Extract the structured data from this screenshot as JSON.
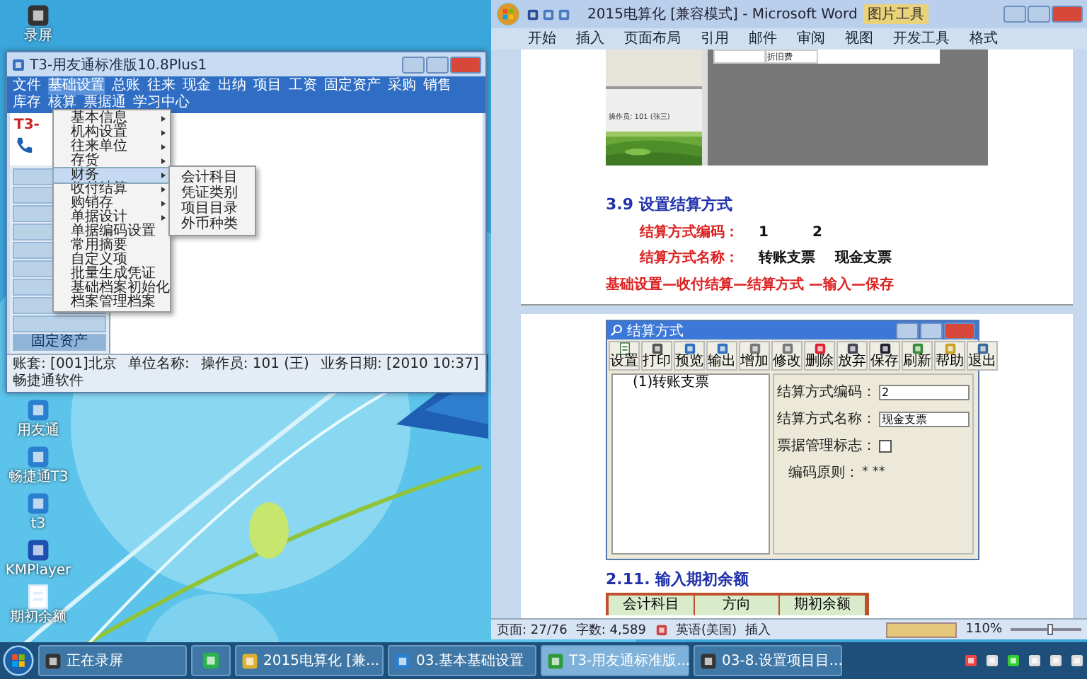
{
  "desktop_icons": [
    {
      "label": "录屏"
    },
    {
      "label": "用友通"
    },
    {
      "label": "畅捷通T3"
    },
    {
      "label": "t3"
    },
    {
      "label": "KMPlayer"
    },
    {
      "label": "期初余额"
    }
  ],
  "t3_window": {
    "title": "T3-用友通标准版10.8Plus1",
    "menu": [
      {
        "label": "文件",
        "selected": false
      },
      {
        "label": "基础设置",
        "selected": true
      },
      {
        "label": "总账",
        "selected": false
      },
      {
        "label": "往来",
        "selected": false
      },
      {
        "label": "现金",
        "selected": false
      },
      {
        "label": "出纳",
        "selected": false
      },
      {
        "label": "项目",
        "selected": false
      },
      {
        "label": "工资",
        "selected": false
      },
      {
        "label": "固定资产",
        "selected": false
      },
      {
        "label": "采购",
        "selected": false
      },
      {
        "label": "销售",
        "selected": false
      },
      {
        "label": "库存",
        "selected": false
      },
      {
        "label": "核算",
        "selected": false
      },
      {
        "label": "票据通",
        "selected": false
      },
      {
        "label": "学习中心",
        "selected": false
      }
    ],
    "logo": "T3-",
    "nav_items": [
      {
        "label": "固定资产",
        "selected": true
      }
    ],
    "dropdown": [
      {
        "label": "基本信息",
        "submenu": true,
        "selected": false
      },
      {
        "label": "机构设置",
        "submenu": true,
        "selected": false
      },
      {
        "label": "往来单位",
        "submenu": true,
        "selected": false
      },
      {
        "label": "存货",
        "submenu": true,
        "selected": false
      },
      {
        "label": "财务",
        "submenu": true,
        "selected": true
      },
      {
        "label": "收付结算",
        "submenu": true,
        "selected": false
      },
      {
        "label": "购销存",
        "submenu": true,
        "selected": false
      },
      {
        "label": "单据设计",
        "submenu": true,
        "selected": false
      },
      {
        "label": "单据编码设置",
        "submenu": false,
        "selected": false
      },
      {
        "label": "常用摘要",
        "submenu": false,
        "selected": false
      },
      {
        "label": "自定义项",
        "submenu": false,
        "selected": false
      },
      {
        "label": "批量生成凭证",
        "submenu": false,
        "selected": false
      },
      {
        "label": "基础档案初始化",
        "submenu": false,
        "selected": false
      },
      {
        "label": "档案管理档案",
        "submenu": false,
        "selected": false
      }
    ],
    "submenu": [
      "会计科目",
      "凭证类别",
      "项目目录",
      "外币种类"
    ],
    "status": [
      "账套: [001]北京",
      "单位名称:",
      "操作员: 101 (王)",
      "业务日期: [2010 10:37]",
      "畅捷通软件"
    ]
  },
  "word_window": {
    "title": "2015电算化 [兼容模式] - Microsoft Word",
    "context_tab": "图片工具",
    "tabs": [
      "开始",
      "插入",
      "页面布局",
      "引用",
      "邮件",
      "审阅",
      "视图",
      "开发工具",
      "格式"
    ],
    "figure_texts": [
      "折旧费",
      "操作员: 101 (张三)"
    ],
    "heading": "3.9 设置结算方式",
    "lines": [
      {
        "label": "结算方式编码：",
        "values": [
          "1",
          "2"
        ]
      },
      {
        "label": "结算方式名称：",
        "values": [
          "转账支票",
          "现金支票"
        ]
      }
    ],
    "path_note": "基础设置—收付结算—结算方式 —输入—保存",
    "dialog": {
      "title": "结算方式",
      "tools": [
        "设置",
        "打印",
        "预览",
        "输出",
        "增加",
        "修改",
        "删除",
        "放弃",
        "保存",
        "刷新",
        "帮助",
        "退出"
      ],
      "tree": [
        "(1)转账支票"
      ],
      "fields": [
        {
          "kind": "text",
          "label": "结算方式编码：",
          "value": "2"
        },
        {
          "kind": "text",
          "label": "结算方式名称：",
          "value": "现金支票"
        },
        {
          "kind": "check",
          "label": "票据管理标志：",
          "checked": false
        },
        {
          "kind": "note",
          "label": "编码原则：",
          "value": "* **"
        }
      ]
    },
    "heading2": "2.11. 输入期初余额",
    "table_headers": [
      "会计科目",
      "方向",
      "期初余额"
    ],
    "status": [
      "页面: 27/76",
      "字数: 4,589",
      "英语(美国)",
      "插入"
    ],
    "zoom": "110%",
    "zoom_slider": {
      "level": 0.55
    }
  },
  "taskbar": {
    "items": [
      {
        "kind": "app",
        "label": "正在录屏",
        "selected": false
      },
      {
        "kind": "icon",
        "selected": false
      },
      {
        "kind": "app",
        "label": "2015电算化 [兼...",
        "selected": false
      },
      {
        "kind": "app",
        "label": "03.基本基础设置",
        "selected": false
      },
      {
        "kind": "app",
        "label": "T3-用友通标准版...",
        "selected": true
      },
      {
        "kind": "app",
        "label": "03-8.设置项目目...",
        "selected": false
      }
    ]
  }
}
